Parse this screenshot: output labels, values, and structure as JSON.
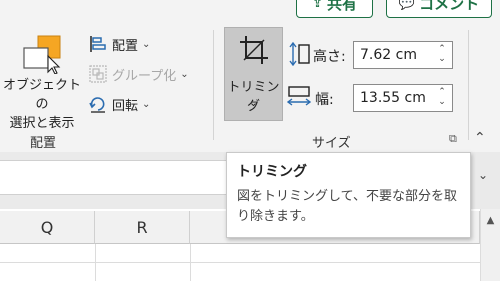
{
  "header": {
    "share_label": "共有",
    "comment_label": "コメント"
  },
  "arrange_group": {
    "select_pane_label_line1": "オブジェクトの",
    "select_pane_label_line2": "選択と表示",
    "align_label": "配置",
    "group_label": "グループ化",
    "rotate_label": "回転",
    "group_name": "配置"
  },
  "size_group": {
    "crop_label": "トリミング",
    "height_label": "高さ:",
    "height_value": "7.62 cm",
    "width_label": "幅:",
    "width_value": "13.55 cm",
    "group_name": "サイズ"
  },
  "grid": {
    "columns": [
      "Q",
      "R"
    ]
  },
  "tooltip": {
    "title": "トリミング",
    "body_line1": "図をトリミングして、不要な部分を取",
    "body_line2": "り除きます。"
  },
  "colors": {
    "brand": "#1e7145",
    "ribbon_bg": "#f3f3f3",
    "icon_blue": "#2b6cb0",
    "icon_orange": "#f5a623"
  }
}
